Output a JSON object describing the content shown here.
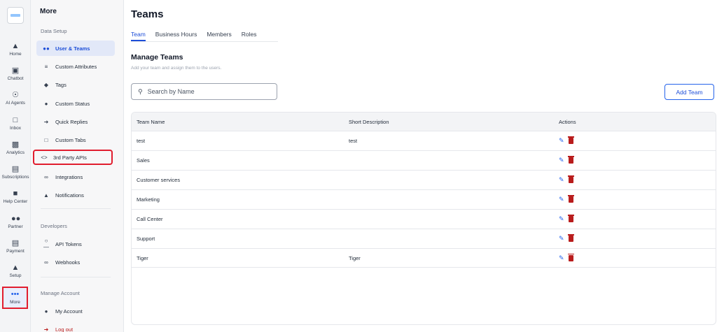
{
  "rail": {
    "items": [
      {
        "label": "Home",
        "icon": "home-icon"
      },
      {
        "label": "Chatbot",
        "icon": "robot-icon"
      },
      {
        "label": "AI Agents",
        "icon": "ai-agent-icon"
      },
      {
        "label": "Inbox",
        "icon": "inbox-icon"
      },
      {
        "label": "Analytics",
        "icon": "chart-icon"
      },
      {
        "label": "Subscriptions",
        "icon": "monitor-icon"
      },
      {
        "label": "Help Center",
        "icon": "help-icon"
      },
      {
        "label": "Partner",
        "icon": "partner-icon"
      },
      {
        "label": "Payment",
        "icon": "card-icon"
      },
      {
        "label": "Setup",
        "icon": "setup-icon"
      },
      {
        "label": "More",
        "icon": "more-icon"
      }
    ]
  },
  "sidebar": {
    "title": "More",
    "sections": {
      "data_setup": "Data Setup",
      "developers": "Developers",
      "manage_account": "Manage Account"
    },
    "items": [
      {
        "label": "User & Teams",
        "icon": "users-icon"
      },
      {
        "label": "Custom Attributes",
        "icon": "list-icon"
      },
      {
        "label": "Tags",
        "icon": "tag-icon"
      },
      {
        "label": "Custom Status",
        "icon": "status-icon"
      },
      {
        "label": "Quick Replies",
        "icon": "bolt-icon"
      },
      {
        "label": "Custom Tabs",
        "icon": "tabs-icon"
      },
      {
        "label": "3rd Party APIs",
        "icon": "code-icon"
      },
      {
        "label": "Integrations",
        "icon": "link-icon"
      },
      {
        "label": "Notifications",
        "icon": "bell-icon"
      },
      {
        "label": "API Tokens",
        "icon": "key-icon"
      },
      {
        "label": "Webhooks",
        "icon": "webhook-icon"
      },
      {
        "label": "My Account",
        "icon": "person-icon"
      },
      {
        "label": "Log out",
        "icon": "logout-icon"
      }
    ]
  },
  "main": {
    "title": "Teams",
    "tabs": [
      "Team",
      "Business Hours",
      "Members",
      "Roles"
    ],
    "section_title": "Manage Teams",
    "section_subtitle": "Add your team and assign them to the users.",
    "search_placeholder": "Search by Name",
    "add_button": "Add Team",
    "table": {
      "headers": [
        "Team Name",
        "Short Description",
        "Actions"
      ],
      "rows": [
        {
          "name": "test",
          "description": "test"
        },
        {
          "name": "Sales",
          "description": ""
        },
        {
          "name": "Customer services",
          "description": ""
        },
        {
          "name": "Marketing",
          "description": ""
        },
        {
          "name": "Call Center",
          "description": ""
        },
        {
          "name": "Support",
          "description": ""
        },
        {
          "name": "Tiger",
          "description": "Tiger"
        }
      ]
    }
  },
  "colors": {
    "accent": "#1d4ed8",
    "highlight_box": "#e11d2e",
    "delete": "#b91c1c"
  }
}
